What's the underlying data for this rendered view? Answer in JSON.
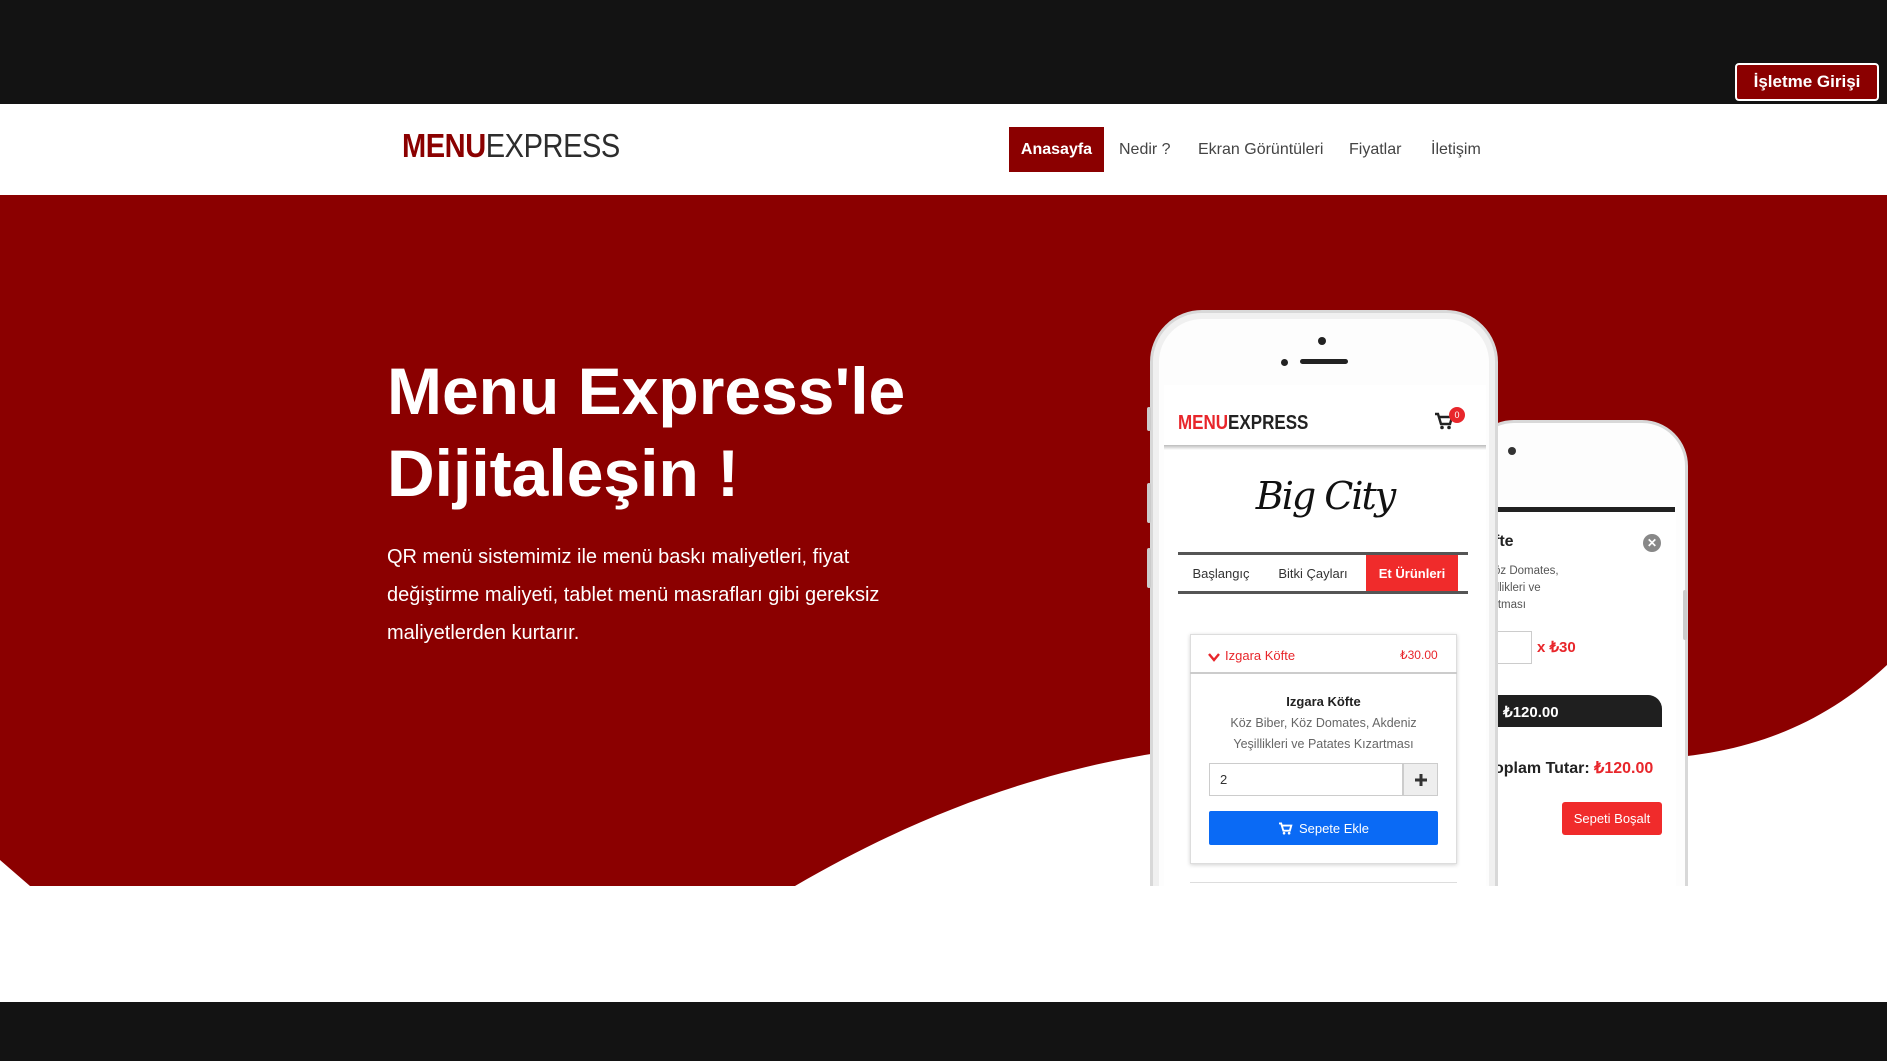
{
  "topbar": {
    "business_login": "İşletme Girişi"
  },
  "brand": {
    "part1": "MENU",
    "part2": "EXPRESS"
  },
  "nav": {
    "items": [
      {
        "label": "Anasayfa",
        "active": true
      },
      {
        "label": "Nedir ?"
      },
      {
        "label": "Ekran Görüntüleri"
      },
      {
        "label": "Fiyatlar"
      },
      {
        "label": "İletişim"
      }
    ]
  },
  "hero": {
    "title_line1": "Menu Express'le",
    "title_line2": "Dijitaleşin !",
    "text": "QR menü sistemimiz ile menü baskı maliyetleri, fiyat değiştirme maliyeti, tablet menü masrafları gibi gereksiz maliyetlerden kurtarır."
  },
  "phone_front": {
    "logo_part1": "MENU",
    "logo_part2": "EXPRESS",
    "cart_count": "0",
    "shop_name": "Big City",
    "tabs": [
      "Başlangıç",
      "Bitki Çayları",
      "Et Ürünleri"
    ],
    "active_tab": "Et Ürünleri",
    "item": {
      "name": "Izgara Köfte",
      "price": "₺30.00",
      "title": "Izgara Köfte",
      "description": "Köz Biber, Köz Domates, Akdeniz Yeşillikleri ve Patates Kızartması",
      "quantity": "2",
      "add_button": "Sepete Ekle"
    }
  },
  "phone_back": {
    "item_name_partial": "fte",
    "desc_line1": "öz Domates,",
    "desc_line2": "illikleri ve",
    "desc_line3": "rtması",
    "unit_price": "x ₺30",
    "subtotal": ": ₺120.00",
    "total_label": "oplam Tutar: ",
    "total_value": "₺120.00",
    "empty_cart": "Sepeti Boşalt"
  },
  "colors": {
    "brand_red": "#8b0000",
    "accent_red": "#f02b2b",
    "button_blue": "#0a6af5",
    "dark": "#131313"
  }
}
